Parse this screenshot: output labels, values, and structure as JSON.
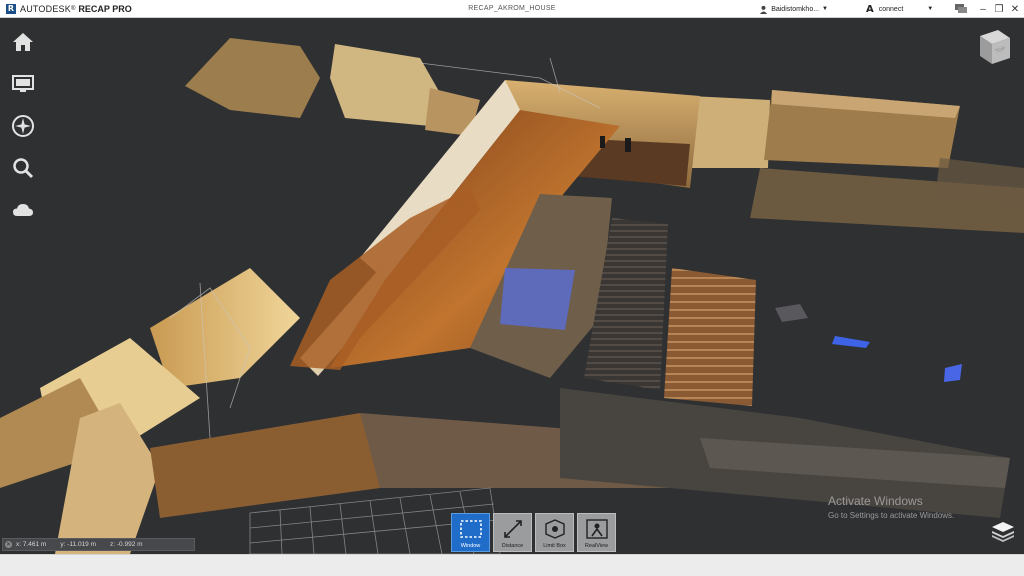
{
  "titlebar": {
    "brand": "AUTODESK",
    "product": "RECAP PRO",
    "document": "RECAP_AKROM_HOUSE",
    "user": "Baidistomkho...",
    "connect": "connect"
  },
  "nav": {
    "items": [
      {
        "name": "home",
        "icon": "home-icon"
      },
      {
        "name": "display",
        "icon": "monitor-icon"
      },
      {
        "name": "navigate",
        "icon": "compass-icon"
      },
      {
        "name": "search",
        "icon": "search-icon"
      },
      {
        "name": "cloud",
        "icon": "cloud-icon"
      }
    ]
  },
  "viewcube": {
    "face": "TOP",
    "icon": "viewcube-icon"
  },
  "coords": {
    "x": "x: 7.461  m",
    "y": "y: -11.019  m",
    "z": "z: -0.992  m"
  },
  "tools": [
    {
      "label": "Window",
      "active": true,
      "icon": "window-select-icon"
    },
    {
      "label": "Distance",
      "active": false,
      "icon": "distance-icon"
    },
    {
      "label": "Limit Box",
      "active": false,
      "icon": "limit-box-icon"
    },
    {
      "label": "RealView",
      "active": false,
      "icon": "realview-icon"
    }
  ],
  "watermark": {
    "title": "Activate Windows",
    "subtitle": "Go to Settings to activate Windows."
  },
  "colors": {
    "viewport_bg": "#2f3032",
    "accent": "#1f6dc8",
    "warm_wall": "#b88a4a",
    "bright_wall": "#e6c98a"
  }
}
